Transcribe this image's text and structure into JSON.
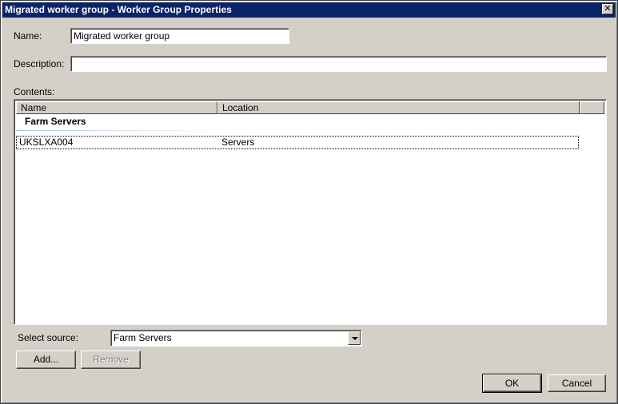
{
  "window": {
    "title": "Migrated worker group - Worker Group Properties",
    "close_glyph": "✕"
  },
  "form": {
    "name_label": "Name:",
    "name_value": "Migrated worker group",
    "description_label": "Description:",
    "description_value": "",
    "contents_label": "Contents:"
  },
  "list": {
    "columns": [
      "Name",
      "Location",
      ""
    ],
    "group_header": "Farm Servers",
    "rows": [
      {
        "name": "UKSLXA004",
        "location": "Servers"
      }
    ]
  },
  "source": {
    "label": "Select source:",
    "selected": "Farm Servers"
  },
  "buttons": {
    "add": "Add...",
    "remove": "Remove",
    "ok": "OK",
    "cancel": "Cancel"
  }
}
